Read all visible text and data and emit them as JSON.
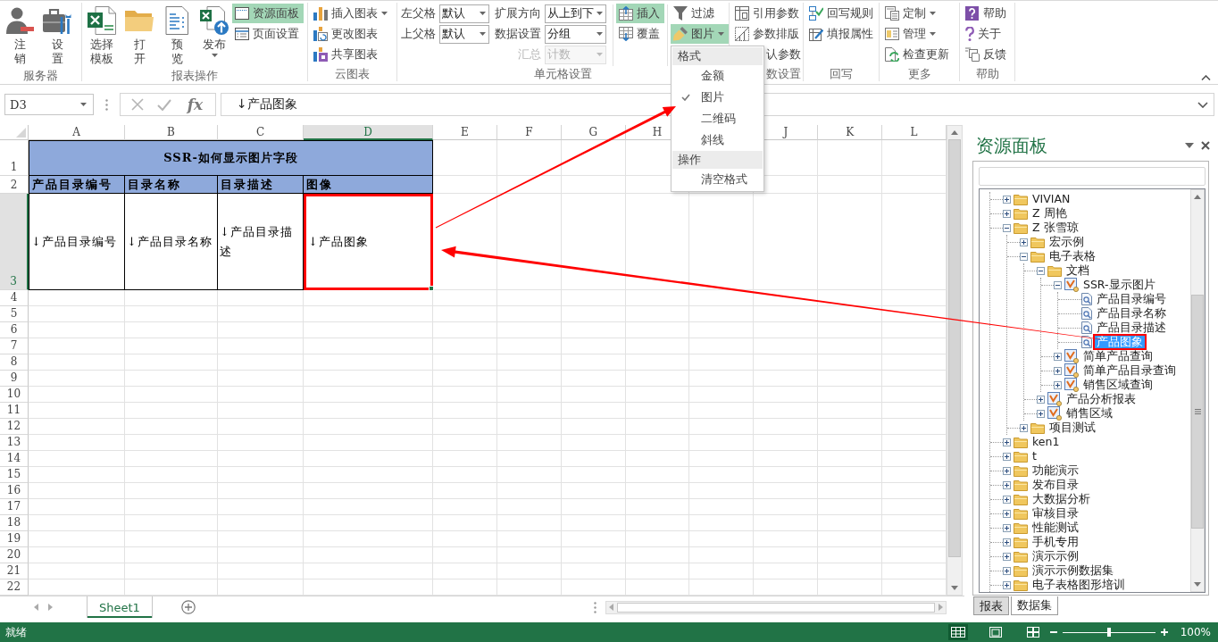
{
  "ribbon": {
    "groups": [
      {
        "label": "服务器",
        "stacks": [
          {
            "kind": "large",
            "items": [
              {
                "label": "注销",
                "dropdown": false
              },
              {
                "label": "设置",
                "dropdown": false
              }
            ]
          }
        ]
      },
      {
        "label": "报表操作",
        "stacks": [
          {
            "kind": "large",
            "items": [
              {
                "label": "选择模板",
                "dropdown": false
              },
              {
                "label": "打开",
                "dropdown": false
              },
              {
                "label": "预览",
                "dropdown": false
              },
              {
                "label": "发布",
                "dropdown": true
              }
            ]
          },
          {
            "kind": "small",
            "items": [
              {
                "label": "资源面板",
                "on": true,
                "dropdown": false,
                "covered": false
              },
              {
                "label": "页面设置",
                "on": false,
                "dropdown": false,
                "covered": false
              }
            ]
          }
        ]
      },
      {
        "label": "云图表",
        "stacks": [
          {
            "kind": "small",
            "items": [
              {
                "label": "插入图表",
                "on": false,
                "dropdown": true,
                "covered": false
              },
              {
                "label": "更改图表",
                "on": false,
                "dropdown": false,
                "covered": false
              },
              {
                "label": "共享图表",
                "on": false,
                "dropdown": false,
                "covered": false
              }
            ]
          }
        ]
      },
      {
        "label": "单元格设置",
        "stacks": [
          {
            "kind": "select",
            "items": [
              {
                "label": "左父格",
                "value": "默认",
                "disabled": false
              },
              {
                "label": "上父格",
                "value": "默认",
                "disabled": false
              }
            ]
          },
          {
            "kind": "select",
            "items": [
              {
                "label": "扩展方向",
                "value": "从上到下",
                "disabled": false
              },
              {
                "label": "数据设置",
                "value": "分组",
                "disabled": false
              },
              {
                "label": "汇总",
                "value": "计数",
                "disabled": true
              }
            ]
          },
          {
            "kind": "small",
            "items": [
              {
                "label": "插入",
                "on": true,
                "dropdown": false,
                "covered": false
              },
              {
                "label": "覆盖",
                "on": false,
                "dropdown": false,
                "covered": false
              }
            ]
          },
          {
            "kind": "small",
            "items": [
              {
                "label": "过滤",
                "on": false,
                "dropdown": false,
                "covered": false
              },
              {
                "label": "图片",
                "on": true,
                "dropdown": true,
                "covered": false,
                "menu": {
                  "sections": [
                    {
                      "title": "格式",
                      "items": [
                        {
                          "label": "金额",
                          "checked": false
                        },
                        {
                          "label": "图片",
                          "checked": true
                        },
                        {
                          "label": "二维码",
                          "checked": false
                        },
                        {
                          "label": "斜线",
                          "checked": false
                        }
                      ]
                    },
                    {
                      "title": "操作",
                      "items": [
                        {
                          "label": "清空格式",
                          "checked": false
                        }
                      ]
                    }
                  ]
                }
              }
            ]
          }
        ]
      },
      {
        "label": "数设置",
        "stacks": [
          {
            "kind": "small",
            "items": [
              {
                "label": "引用参数",
                "on": false,
                "dropdown": false,
                "covered": false
              },
              {
                "label": "参数排版",
                "on": false,
                "dropdown": false,
                "covered": false
              },
              {
                "label": "认参数",
                "on": false,
                "dropdown": false,
                "covered": true
              }
            ]
          }
        ]
      },
      {
        "label": "回写",
        "stacks": [
          {
            "kind": "small",
            "items": [
              {
                "label": "回写规则",
                "on": false,
                "dropdown": false,
                "covered": false
              },
              {
                "label": "填报属性",
                "on": false,
                "dropdown": false,
                "covered": false
              }
            ]
          }
        ]
      },
      {
        "label": "更多",
        "stacks": [
          {
            "kind": "small",
            "items": [
              {
                "label": "定制",
                "on": false,
                "dropdown": true,
                "covered": false
              },
              {
                "label": "管理",
                "on": false,
                "dropdown": true,
                "covered": false
              },
              {
                "label": "检查更新",
                "on": false,
                "dropdown": false,
                "covered": false
              }
            ]
          }
        ]
      },
      {
        "label": "帮助",
        "stacks": [
          {
            "kind": "small",
            "items": [
              {
                "label": "帮助",
                "on": false,
                "dropdown": false,
                "covered": false
              },
              {
                "label": "关于",
                "on": false,
                "dropdown": false,
                "covered": false
              },
              {
                "label": "反馈",
                "on": false,
                "dropdown": false,
                "covered": false
              }
            ]
          }
        ]
      }
    ]
  },
  "formula_bar": {
    "name_box": "D3",
    "function_label": "fx",
    "formula": "↓产品图象"
  },
  "sheet": {
    "columns": [
      {
        "label": "A",
        "selected": false
      },
      {
        "label": "B",
        "selected": false
      },
      {
        "label": "C",
        "selected": false
      },
      {
        "label": "D",
        "selected": true
      },
      {
        "label": "E",
        "selected": false
      },
      {
        "label": "F",
        "selected": false
      },
      {
        "label": "G",
        "selected": false
      },
      {
        "label": "H",
        "selected": false
      },
      {},
      {
        "label": "J",
        "selected": false
      },
      {
        "label": "K",
        "selected": false
      },
      {
        "label": "L",
        "selected": false
      }
    ],
    "rows": [
      {
        "label": "1",
        "selected": false
      },
      {
        "label": "2",
        "selected": false
      },
      {
        "label": "3",
        "selected": true
      },
      {
        "label": "4",
        "selected": false
      },
      {
        "label": "5",
        "selected": false
      },
      {
        "label": "6",
        "selected": false
      },
      {
        "label": "7",
        "selected": false
      },
      {
        "label": "8",
        "selected": false
      },
      {
        "label": "9",
        "selected": false
      },
      {
        "label": "10",
        "selected": false
      },
      {
        "label": "11",
        "selected": false
      },
      {
        "label": "12",
        "selected": false
      },
      {
        "label": "13",
        "selected": false
      },
      {
        "label": "14",
        "selected": false
      },
      {
        "label": "15",
        "selected": false
      },
      {
        "label": "16",
        "selected": false
      },
      {
        "label": "17",
        "selected": false
      },
      {
        "label": "18",
        "selected": false
      },
      {
        "label": "19",
        "selected": false
      },
      {
        "label": "20",
        "selected": false
      },
      {
        "label": "21",
        "selected": false
      },
      {
        "label": "22",
        "selected": false
      }
    ],
    "title": "SSR-如何显示图片字段",
    "headers": [
      "产品目录编号",
      "目录名称",
      "目录描述",
      "图像"
    ],
    "fields": [
      {
        "text": "↓产品目录编号",
        "highlighted": false
      },
      {
        "text": "↓产品目录名称",
        "highlighted": false
      },
      {
        "text": "↓产品目录描述",
        "highlighted": false
      },
      {
        "text": "↓产品图象",
        "highlighted": true
      }
    ]
  },
  "sheet_tabs": [
    {
      "label": "Sheet1",
      "selected": true
    }
  ],
  "resource_panel": {
    "title": "资源面板",
    "tree": [
      {
        "label": "VIVIAN",
        "kind": "folder",
        "expanded": false,
        "selected": false,
        "highlighted": false
      },
      {
        "label": "Z 周艳",
        "kind": "folder",
        "expanded": false,
        "selected": false,
        "highlighted": false
      },
      {
        "label": "Z 张雪琼",
        "kind": "folder",
        "expanded": true,
        "selected": false,
        "highlighted": false,
        "children": [
          {
            "label": "宏示例",
            "kind": "folder",
            "expanded": false,
            "selected": false,
            "highlighted": false
          },
          {
            "label": "电子表格",
            "kind": "folder",
            "expanded": true,
            "selected": false,
            "highlighted": false,
            "children": [
              {
                "label": "文档",
                "kind": "folder",
                "expanded": true,
                "selected": false,
                "highlighted": false,
                "children": [
                  {
                    "label": "SSR-显示图片",
                    "kind": "report",
                    "expanded": true,
                    "selected": false,
                    "highlighted": false,
                    "children": [
                      {
                        "label": "产品目录编号",
                        "kind": "field",
                        "selected": false,
                        "highlighted": false
                      },
                      {
                        "label": "产品目录名称",
                        "kind": "field",
                        "selected": false,
                        "highlighted": false
                      },
                      {
                        "label": "产品目录描述",
                        "kind": "field",
                        "selected": false,
                        "highlighted": false
                      },
                      {
                        "label": "产品图象",
                        "kind": "field",
                        "selected": true,
                        "highlighted": true
                      }
                    ]
                  },
                  {
                    "label": "简单产品查询",
                    "kind": "report",
                    "expanded": false,
                    "selected": false,
                    "highlighted": false
                  },
                  {
                    "label": "简单产品目录查询",
                    "kind": "report",
                    "expanded": false,
                    "selected": false,
                    "highlighted": false
                  },
                  {
                    "label": "销售区域查询",
                    "kind": "report",
                    "expanded": false,
                    "selected": false,
                    "highlighted": false
                  }
                ]
              },
              {
                "label": "产品分析报表",
                "kind": "report",
                "expanded": false,
                "selected": false,
                "highlighted": false
              },
              {
                "label": "销售区域",
                "kind": "report",
                "expanded": false,
                "selected": false,
                "highlighted": false
              }
            ]
          },
          {
            "label": "项目测试",
            "kind": "folder",
            "expanded": false,
            "selected": false,
            "highlighted": false
          }
        ]
      },
      {
        "label": "ken1",
        "kind": "folder",
        "expanded": false,
        "selected": false,
        "highlighted": false
      },
      {
        "label": "t",
        "kind": "folder",
        "expanded": false,
        "selected": false,
        "highlighted": false
      },
      {
        "label": "功能演示",
        "kind": "folder",
        "expanded": false,
        "selected": false,
        "highlighted": false
      },
      {
        "label": "发布目录",
        "kind": "folder",
        "expanded": false,
        "selected": false,
        "highlighted": false
      },
      {
        "label": "大数据分析",
        "kind": "folder",
        "expanded": false,
        "selected": false,
        "highlighted": false
      },
      {
        "label": "审核目录",
        "kind": "folder",
        "expanded": false,
        "selected": false,
        "highlighted": false
      },
      {
        "label": "性能测试",
        "kind": "folder",
        "expanded": false,
        "selected": false,
        "highlighted": false
      },
      {
        "label": "手机专用",
        "kind": "folder",
        "expanded": false,
        "selected": false,
        "highlighted": false
      },
      {
        "label": "演示示例",
        "kind": "folder",
        "expanded": false,
        "selected": false,
        "highlighted": false
      },
      {
        "label": "演示示例数据集",
        "kind": "folder",
        "expanded": false,
        "selected": false,
        "highlighted": false
      },
      {
        "label": "电子表格图形培训",
        "kind": "folder",
        "expanded": false,
        "selected": false,
        "highlighted": false
      }
    ],
    "tabs": [
      {
        "label": "报表",
        "selected": false
      },
      {
        "label": "数据集",
        "selected": true
      }
    ]
  },
  "status_bar": {
    "text": "就绪",
    "views": [
      {
        "selected": true
      },
      {
        "selected": false
      },
      {
        "selected": false
      }
    ],
    "zoom": {
      "level": 0.5,
      "reading": "100%"
    }
  }
}
